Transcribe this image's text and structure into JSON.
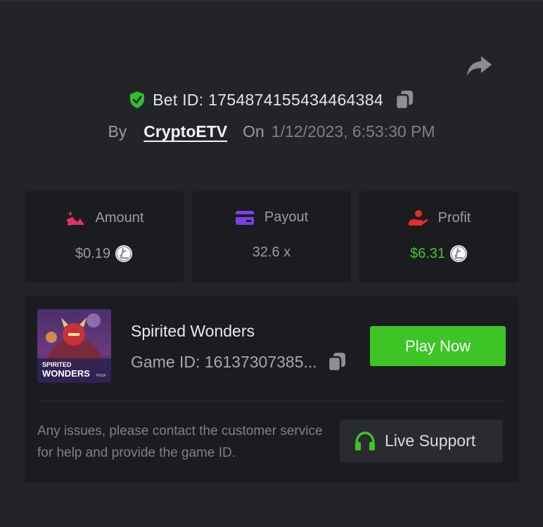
{
  "bet": {
    "label": "Bet ID: ",
    "id": "1754874155434464384",
    "by_label": "By",
    "username": "CryptoETV",
    "on_label": "On",
    "datetime": "1/12/2023, 6:53:30 PM"
  },
  "stats": [
    {
      "label": "Amount",
      "value": "$0.19",
      "icon": "amount-icon",
      "currency": "litecoin-icon",
      "color": "#e0306a"
    },
    {
      "label": "Payout",
      "value": "32.6 x",
      "icon": "card-icon",
      "color": "#7b3fe4"
    },
    {
      "label": "Profit",
      "value": "$6.31",
      "icon": "profit-hand-icon",
      "currency": "litecoin-icon",
      "color": "#e02d2d",
      "value_color": "#46c22a"
    }
  ],
  "game": {
    "title": "Spirited Wonders",
    "id_text": "Game ID: 16137307385...",
    "thumb_text_1": "SPIRITED",
    "thumb_text_2": "WONDERS",
    "thumb_brand": "PGSF",
    "play_label": "Play Now"
  },
  "support": {
    "help_text": "Any issues, please contact the customer service for help and provide the game ID.",
    "button_label": "Live Support",
    "accent": "#3dc526"
  }
}
